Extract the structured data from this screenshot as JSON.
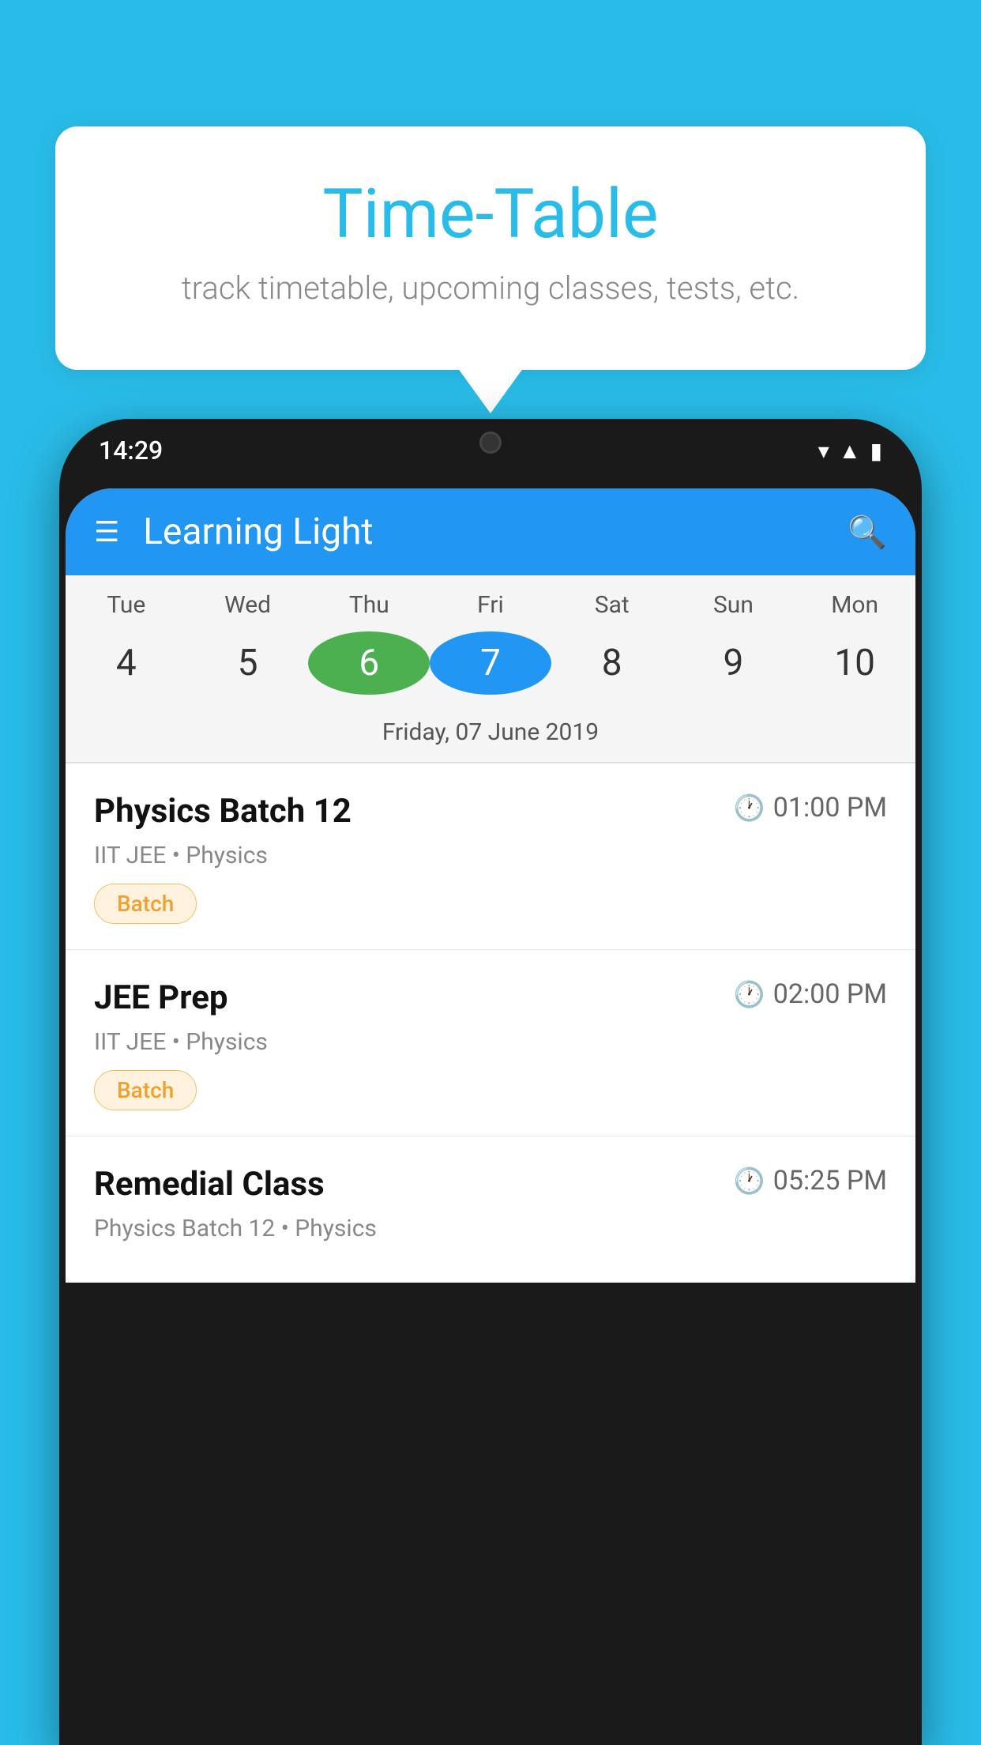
{
  "background_color": "#29bce8",
  "tooltip": {
    "title": "Time-Table",
    "subtitle": "track timetable, upcoming classes, tests, etc."
  },
  "phone": {
    "status_time": "14:29",
    "app_bar_title": "Learning Light",
    "calendar": {
      "day_names": [
        "Tue",
        "Wed",
        "Thu",
        "Fri",
        "Sat",
        "Sun",
        "Mon"
      ],
      "day_numbers": [
        "4",
        "5",
        "6",
        "7",
        "8",
        "9",
        "10"
      ],
      "today_index": 2,
      "selected_index": 3,
      "date_label": "Friday, 07 June 2019"
    },
    "schedule_items": [
      {
        "title": "Physics Batch 12",
        "time": "01:00 PM",
        "subtitle": "IIT JEE • Physics",
        "badge": "Batch"
      },
      {
        "title": "JEE Prep",
        "time": "02:00 PM",
        "subtitle": "IIT JEE • Physics",
        "badge": "Batch"
      },
      {
        "title": "Remedial Class",
        "time": "05:25 PM",
        "subtitle": "Physics Batch 12 • Physics",
        "badge": null
      }
    ]
  }
}
